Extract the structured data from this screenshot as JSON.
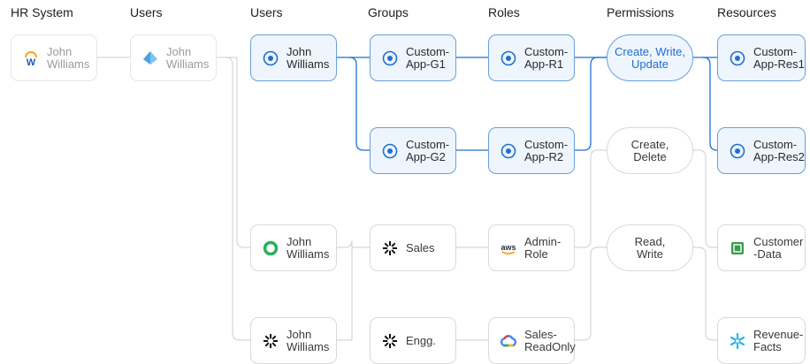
{
  "headers": {
    "hr_system": "HR System",
    "users1": "Users",
    "users2": "Users",
    "groups": "Groups",
    "roles": "Roles",
    "permissions": "Permissions",
    "resources": "Resources"
  },
  "nodes": {
    "hr_user": "John\nWilliams",
    "idp_user": "John\nWilliams",
    "app_user": "John\nWilliams",
    "okta_user": "John\nWilliams",
    "sf_user": "John\nWilliams",
    "group_g1": "Custom-\nApp-G1",
    "group_g2": "Custom-\nApp-G2",
    "group_sales": "Sales",
    "group_engg": "Engg.",
    "role_r1": "Custom-\nApp-R1",
    "role_r2": "Custom-\nApp-R2",
    "role_admin": "Admin-\nRole",
    "role_salesro": "Sales-\nReadOnly",
    "perm_cwu": "Create, Write,\nUpdate",
    "perm_cd": "Create,\nDelete",
    "perm_rw": "Read,\nWrite",
    "res1": "Custom-\nApp-Res1",
    "res2": "Custom-\nApp-Res2",
    "res_customer": "Customer\n-Data",
    "res_revenue": "Revenue-\nFacts"
  },
  "icons": {
    "workday": "workday-icon",
    "azure": "azure-ad-icon",
    "custom_app": "custom-app-icon",
    "okta": "okta-icon",
    "snowflake_logo": "snowflake-logo-icon",
    "aws": "aws-icon",
    "gcp": "google-cloud-icon",
    "dynamodb": "dynamodb-icon",
    "snowflake_db": "snowflake-icon"
  },
  "aws_logo_text": "aws",
  "workday_logo_text": "W",
  "colors": {
    "highlight_line": "#1f6fd1",
    "muted_line": "#cfcfcf",
    "node_blue_bg": "#eef5fd",
    "node_blue_border": "#6b9fd8"
  }
}
